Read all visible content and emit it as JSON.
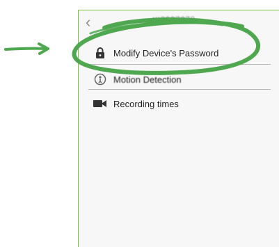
{
  "header": {
    "back_icon": "chevron-left-icon",
    "device_id": "ttt0007070"
  },
  "menu": [
    {
      "icon": "lock-icon",
      "label": "Modify Device's Password"
    },
    {
      "icon": "motion-detection-icon",
      "label": "Motion Detection"
    },
    {
      "icon": "video-camera-icon",
      "label": "Recording times"
    }
  ],
  "annotation": {
    "color": "#4fa84f",
    "arrow_icon": "arrow-right-icon",
    "highlight_icon": "circle-highlight-icon"
  },
  "colors": {
    "panel_border": "#7cc03c",
    "panel_bg": "#f7f7f7",
    "divider": "#b7b7b7"
  }
}
